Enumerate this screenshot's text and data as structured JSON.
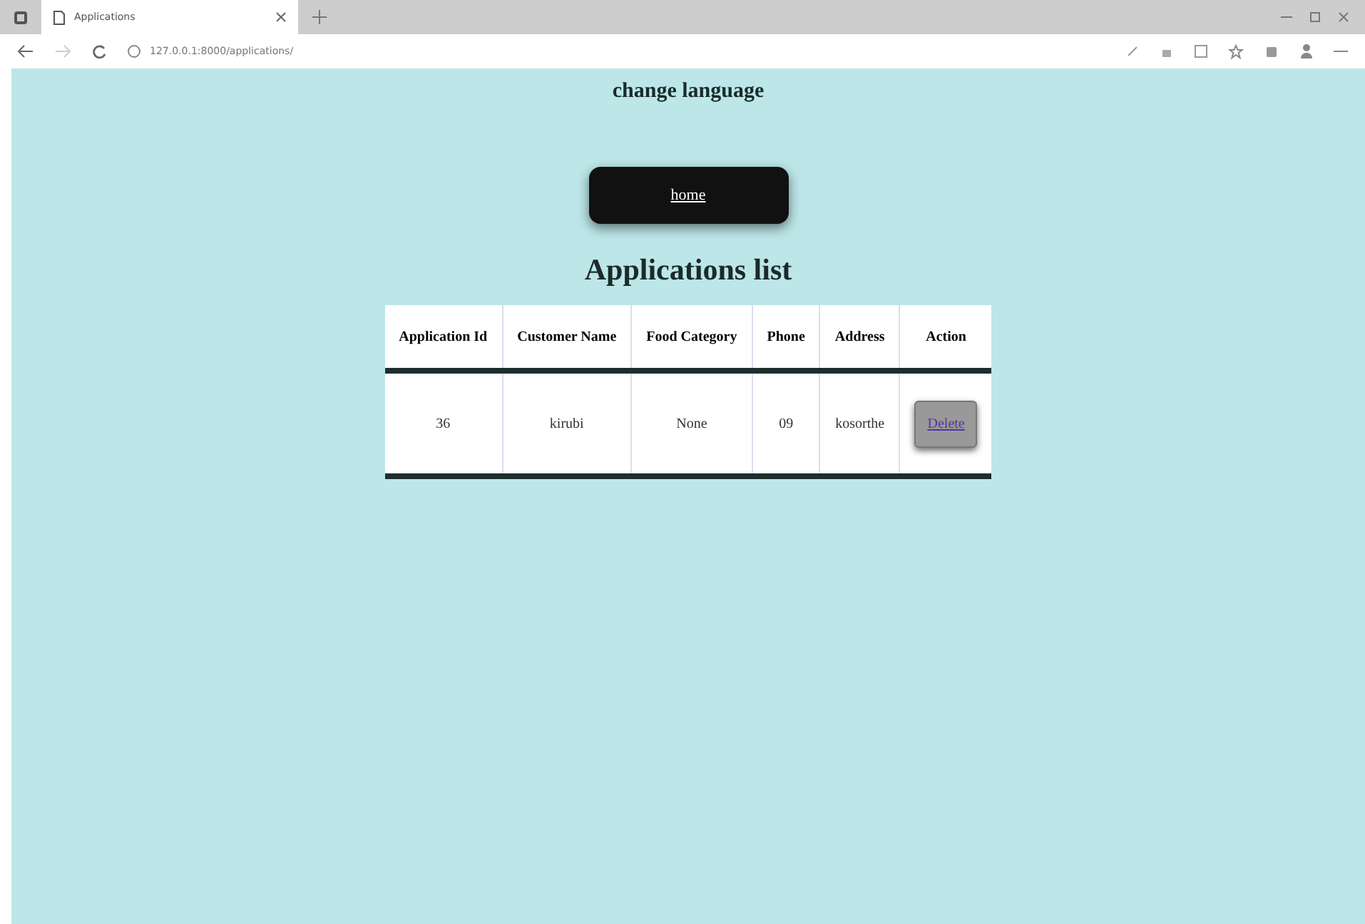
{
  "browser": {
    "tab_title": "Applications",
    "url": "127.0.0.1:8000/applications/"
  },
  "page": {
    "language_link": "change language",
    "home_button": "home",
    "heading": "Applications list"
  },
  "table": {
    "columns": [
      "Application Id",
      "Customer Name",
      "Food Category",
      "Phone",
      "Address",
      "Action"
    ],
    "rows": [
      {
        "cells": [
          "36",
          "kirubi",
          "None",
          "09",
          "kosorthe"
        ],
        "action": "Delete"
      }
    ]
  }
}
